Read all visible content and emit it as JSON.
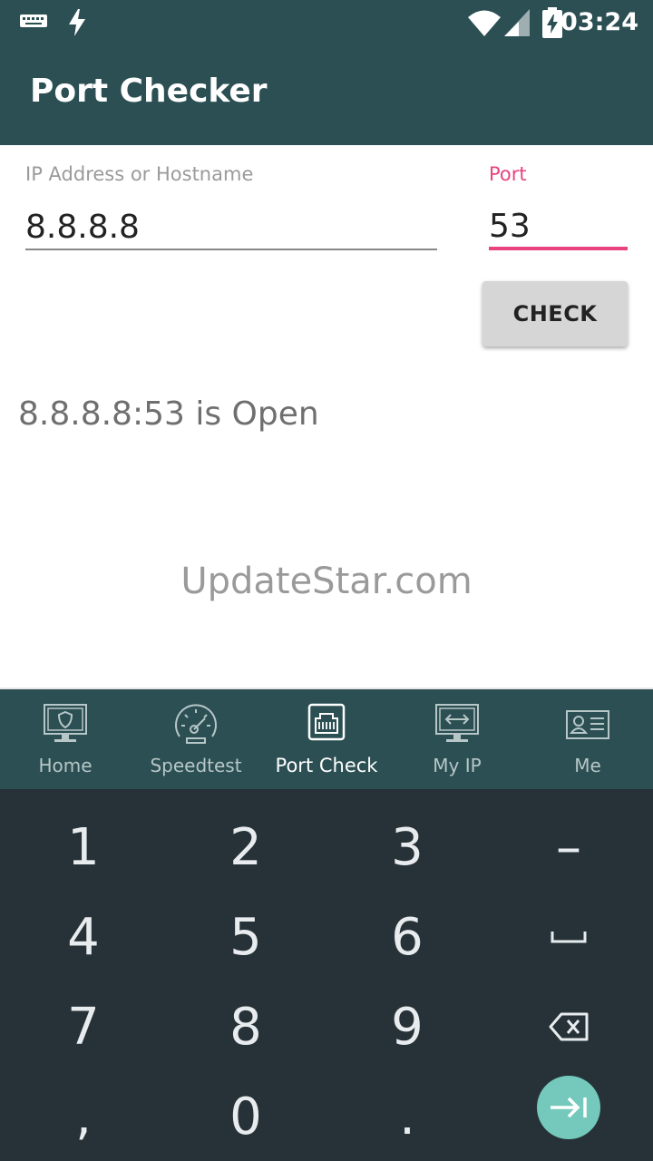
{
  "status_bar": {
    "time": "03:24"
  },
  "app_bar": {
    "title": "Port Checker"
  },
  "form": {
    "host_label": "IP Address or Hostname",
    "host_value": "8.8.8.8",
    "port_label": "Port",
    "port_value": "53",
    "check_label": "CHECK"
  },
  "result": {
    "text": "8.8.8.8:53 is Open"
  },
  "watermark": "UpdateStar.com",
  "bottom_nav": {
    "items": [
      {
        "label": "Home",
        "icon": "shield-monitor-icon"
      },
      {
        "label": "Speedtest",
        "icon": "speedometer-icon"
      },
      {
        "label": "Port Check",
        "icon": "ethernet-port-icon",
        "active": true
      },
      {
        "label": "My IP",
        "icon": "monitor-arrows-icon"
      },
      {
        "label": "Me",
        "icon": "id-card-icon"
      }
    ]
  },
  "keyboard": {
    "rows": [
      [
        "1",
        "2",
        "3",
        "–"
      ],
      [
        "4",
        "5",
        "6",
        "space"
      ],
      [
        "7",
        "8",
        "9",
        "backspace"
      ],
      [
        ",",
        "0",
        ".",
        "enter"
      ]
    ]
  },
  "colors": {
    "primary": "#2b4f53",
    "accent": "#e8437f",
    "keyboard_bg": "#263238",
    "enter_key": "#74c9bc"
  }
}
